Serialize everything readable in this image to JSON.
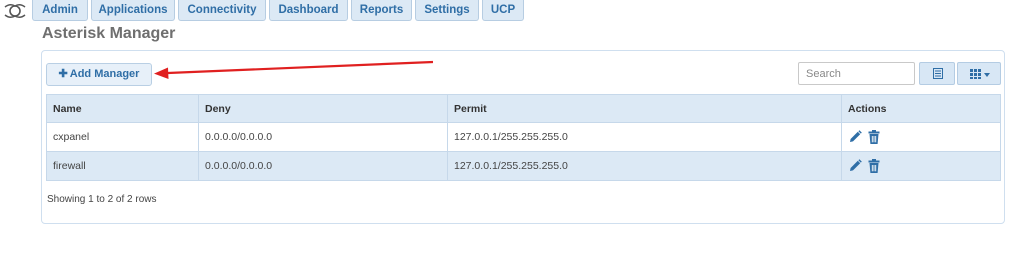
{
  "nav": {
    "tabs": [
      {
        "label": "Admin"
      },
      {
        "label": "Applications"
      },
      {
        "label": "Connectivity"
      },
      {
        "label": "Dashboard"
      },
      {
        "label": "Reports"
      },
      {
        "label": "Settings"
      },
      {
        "label": "UCP"
      }
    ]
  },
  "page": {
    "title": "Asterisk Manager"
  },
  "toolbar": {
    "add_label": "Add Manager",
    "search_placeholder": "Search"
  },
  "table": {
    "columns": [
      "Name",
      "Deny",
      "Permit",
      "Actions"
    ],
    "rows": [
      {
        "name": "cxpanel",
        "deny": "0.0.0.0/0.0.0.0",
        "permit": "127.0.0.1/255.255.255.0"
      },
      {
        "name": "firewall",
        "deny": "0.0.0.0/0.0.0.0",
        "permit": "127.0.0.1/255.255.255.0"
      }
    ]
  },
  "footer": {
    "pagination_text": "Showing 1 to 2 of 2 rows"
  },
  "colors": {
    "accent": "#2f6ea6",
    "tab_bg": "#dce9f5",
    "annotation_arrow": "#e02020"
  },
  "icons": [
    "freepbx-logo-icon",
    "plus-icon",
    "list-view-icon",
    "grid-columns-icon",
    "caret-down-icon",
    "edit-pencil-icon",
    "trash-icon"
  ]
}
